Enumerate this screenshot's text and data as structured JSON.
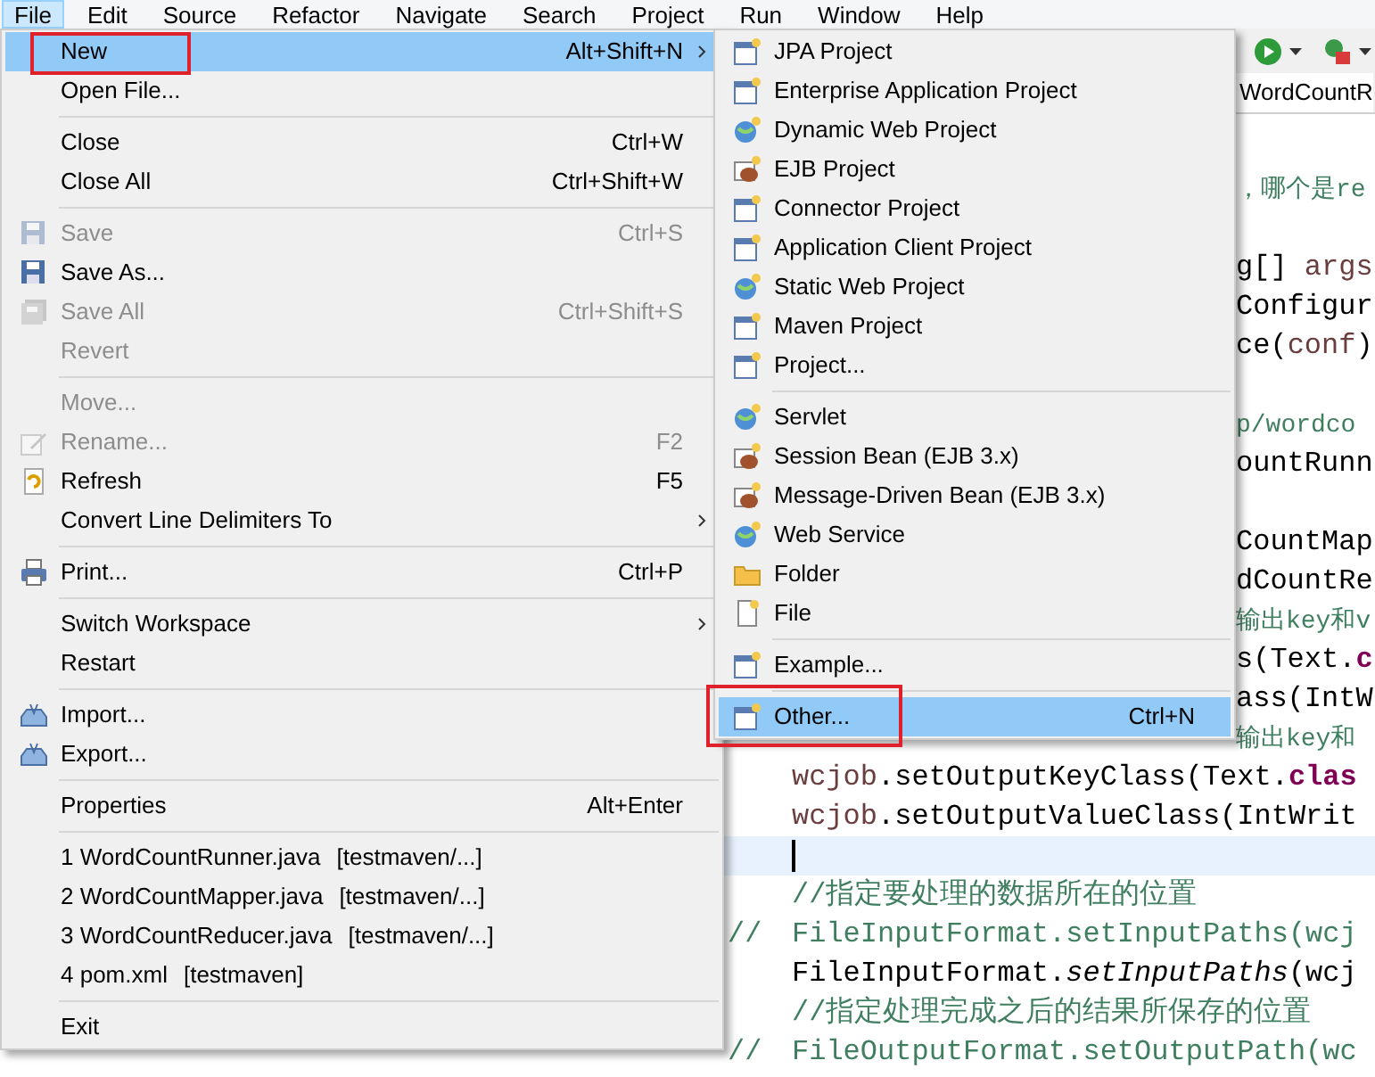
{
  "menu_bar": [
    {
      "label": "File",
      "selected": true
    },
    {
      "label": "Edit",
      "selected": false
    },
    {
      "label": "Source",
      "selected": false
    },
    {
      "label": "Refactor",
      "selected": false
    },
    {
      "label": "Navigate",
      "selected": false
    },
    {
      "label": "Search",
      "selected": false
    },
    {
      "label": "Project",
      "selected": false
    },
    {
      "label": "Run",
      "selected": false
    },
    {
      "label": "Window",
      "selected": false
    },
    {
      "label": "Help",
      "selected": false
    }
  ],
  "editor": {
    "tab": "WordCountR",
    "lines": [
      {
        "kind": "covered",
        "segments": [
          {
            "kind": "comment",
            "text": "，哪个是re"
          }
        ]
      },
      {
        "kind": "blank"
      },
      {
        "kind": "covered",
        "segments": [
          {
            "kind": "plain",
            "text": "g[] "
          },
          {
            "kind": "variable",
            "text": "args"
          }
        ]
      },
      {
        "kind": "covered",
        "segments": [
          {
            "kind": "plain",
            "text": "Configur"
          }
        ]
      },
      {
        "kind": "covered",
        "segments": [
          {
            "kind": "plain",
            "text": "ce("
          },
          {
            "kind": "variable",
            "text": "conf"
          },
          {
            "kind": "plain",
            "text": ")"
          }
        ]
      },
      {
        "kind": "blank"
      },
      {
        "kind": "covered",
        "segments": [
          {
            "kind": "comment",
            "text": "p/wordco"
          }
        ]
      },
      {
        "kind": "covered",
        "segments": [
          {
            "kind": "plain",
            "text": "ountRunn"
          }
        ]
      },
      {
        "kind": "blank"
      },
      {
        "kind": "covered",
        "segments": [
          {
            "kind": "plain",
            "text": "CountMap"
          }
        ]
      },
      {
        "kind": "covered",
        "segments": [
          {
            "kind": "plain",
            "text": "dCountRe"
          }
        ]
      },
      {
        "kind": "covered",
        "segments": [
          {
            "kind": "comment",
            "text": "输出key和v"
          }
        ]
      },
      {
        "kind": "covered",
        "segments": [
          {
            "kind": "plain",
            "text": "s(Text."
          },
          {
            "kind": "keyword",
            "text": "c"
          }
        ]
      },
      {
        "kind": "covered",
        "segments": [
          {
            "kind": "plain",
            "text": "ass(IntW"
          }
        ]
      },
      {
        "kind": "covered",
        "segments": [
          {
            "kind": "comment",
            "text": "输出key和"
          }
        ]
      },
      {
        "kind": "full",
        "segments": [
          {
            "kind": "variable",
            "text": "wcjob"
          },
          {
            "kind": "plain",
            "text": ".setOutputKeyClass(Text."
          },
          {
            "kind": "keyword",
            "text": "clas"
          }
        ]
      },
      {
        "kind": "full",
        "segments": [
          {
            "kind": "variable",
            "text": "wcjob"
          },
          {
            "kind": "plain",
            "text": ".setOutputValueClass(IntWrit"
          }
        ]
      },
      {
        "kind": "cursor"
      },
      {
        "kind": "full",
        "segments": [
          {
            "kind": "comment",
            "text": "//指定要处理的数据所在的位置"
          }
        ]
      },
      {
        "kind": "commented",
        "prefix": "//",
        "segments": [
          {
            "kind": "comment",
            "text": "FileInputFormat.setInputPaths(wcj"
          }
        ]
      },
      {
        "kind": "full",
        "segments": [
          {
            "kind": "plain",
            "text": "FileInputFormat."
          },
          {
            "kind": "italic",
            "text": "setInputPaths"
          },
          {
            "kind": "plain",
            "text": "(wcj"
          }
        ]
      },
      {
        "kind": "full",
        "segments": [
          {
            "kind": "comment",
            "text": "//指定处理完成之后的结果所保存的位置"
          }
        ]
      },
      {
        "kind": "commented",
        "prefix": "//",
        "segments": [
          {
            "kind": "comment",
            "text": "FileOutputFormat.setOutputPath(wc"
          }
        ]
      }
    ]
  },
  "file_menu": {
    "items": [
      {
        "kind": "item",
        "label": "New",
        "shortcut": "Alt+Shift+N",
        "selected": true,
        "disabled": false,
        "submenu": true,
        "annotated": true
      },
      {
        "kind": "item",
        "label": "Open File...",
        "selected": false,
        "disabled": false,
        "submenu": false,
        "annotated": false
      },
      {
        "kind": "separator"
      },
      {
        "kind": "item",
        "label": "Close",
        "shortcut": "Ctrl+W",
        "selected": false,
        "disabled": false,
        "submenu": false,
        "annotated": false
      },
      {
        "kind": "item",
        "label": "Close All",
        "shortcut": "Ctrl+Shift+W",
        "selected": false,
        "disabled": false,
        "submenu": false,
        "annotated": false
      },
      {
        "kind": "separator"
      },
      {
        "kind": "item",
        "label": "Save",
        "shortcut": "Ctrl+S",
        "selected": false,
        "disabled": true,
        "submenu": false,
        "annotated": false
      },
      {
        "kind": "item",
        "label": "Save As...",
        "selected": false,
        "disabled": false,
        "submenu": false,
        "annotated": false
      },
      {
        "kind": "item",
        "label": "Save All",
        "shortcut": "Ctrl+Shift+S",
        "selected": false,
        "disabled": true,
        "submenu": false,
        "annotated": false
      },
      {
        "kind": "item",
        "label": "Revert",
        "selected": false,
        "disabled": true,
        "submenu": false,
        "annotated": false
      },
      {
        "kind": "separator"
      },
      {
        "kind": "item",
        "label": "Move...",
        "selected": false,
        "disabled": true,
        "submenu": false,
        "annotated": false
      },
      {
        "kind": "item",
        "label": "Rename...",
        "shortcut": "F2",
        "selected": false,
        "disabled": true,
        "submenu": false,
        "annotated": false
      },
      {
        "kind": "item",
        "label": "Refresh",
        "shortcut": "F5",
        "selected": false,
        "disabled": false,
        "submenu": false,
        "annotated": false
      },
      {
        "kind": "item",
        "label": "Convert Line Delimiters To",
        "selected": false,
        "disabled": false,
        "submenu": true,
        "annotated": false
      },
      {
        "kind": "separator"
      },
      {
        "kind": "item",
        "label": "Print...",
        "shortcut": "Ctrl+P",
        "selected": false,
        "disabled": false,
        "submenu": false,
        "annotated": false
      },
      {
        "kind": "separator"
      },
      {
        "kind": "item",
        "label": "Switch Workspace",
        "selected": false,
        "disabled": false,
        "submenu": true,
        "annotated": false
      },
      {
        "kind": "item",
        "label": "Restart",
        "selected": false,
        "disabled": false,
        "submenu": false,
        "annotated": false
      },
      {
        "kind": "separator"
      },
      {
        "kind": "item",
        "label": "Import...",
        "selected": false,
        "disabled": false,
        "submenu": false,
        "annotated": false
      },
      {
        "kind": "item",
        "label": "Export...",
        "selected": false,
        "disabled": false,
        "submenu": false,
        "annotated": false
      },
      {
        "kind": "separator"
      },
      {
        "kind": "item",
        "label": "Properties",
        "shortcut": "Alt+Enter",
        "selected": false,
        "disabled": false,
        "submenu": false,
        "annotated": false
      },
      {
        "kind": "separator"
      },
      {
        "kind": "item",
        "label": "1 WordCountRunner.java",
        "detail": "[testmaven/...]",
        "selected": false,
        "disabled": false,
        "submenu": false,
        "annotated": false
      },
      {
        "kind": "item",
        "label": "2 WordCountMapper.java",
        "detail": "[testmaven/...]",
        "selected": false,
        "disabled": false,
        "submenu": false,
        "annotated": false
      },
      {
        "kind": "item",
        "label": "3 WordCountReducer.java",
        "detail": "[testmaven/...]",
        "selected": false,
        "disabled": false,
        "submenu": false,
        "annotated": false
      },
      {
        "kind": "item",
        "label": "4 pom.xml",
        "detail": "[testmaven]",
        "selected": false,
        "disabled": false,
        "submenu": false,
        "annotated": false
      },
      {
        "kind": "separator"
      },
      {
        "kind": "item",
        "label": "Exit",
        "selected": false,
        "disabled": false,
        "submenu": false,
        "annotated": false
      }
    ]
  },
  "new_submenu": {
    "items": [
      {
        "kind": "item",
        "label": "JPA Project",
        "selected": false,
        "annotated": false
      },
      {
        "kind": "item",
        "label": "Enterprise Application Project",
        "selected": false,
        "annotated": false
      },
      {
        "kind": "item",
        "label": "Dynamic Web Project",
        "selected": false,
        "annotated": false
      },
      {
        "kind": "item",
        "label": "EJB Project",
        "selected": false,
        "annotated": false
      },
      {
        "kind": "item",
        "label": "Connector Project",
        "selected": false,
        "annotated": false
      },
      {
        "kind": "item",
        "label": "Application Client Project",
        "selected": false,
        "annotated": false
      },
      {
        "kind": "item",
        "label": "Static Web Project",
        "selected": false,
        "annotated": false
      },
      {
        "kind": "item",
        "label": "Maven Project",
        "selected": false,
        "annotated": false
      },
      {
        "kind": "item",
        "label": "Project...",
        "selected": false,
        "annotated": false
      },
      {
        "kind": "separator"
      },
      {
        "kind": "item",
        "label": "Servlet",
        "selected": false,
        "annotated": false
      },
      {
        "kind": "item",
        "label": "Session Bean (EJB 3.x)",
        "selected": false,
        "annotated": false
      },
      {
        "kind": "item",
        "label": "Message-Driven Bean (EJB 3.x)",
        "selected": false,
        "annotated": false
      },
      {
        "kind": "item",
        "label": "Web Service",
        "selected": false,
        "annotated": false
      },
      {
        "kind": "item",
        "label": "Folder",
        "selected": false,
        "annotated": false
      },
      {
        "kind": "item",
        "label": "File",
        "selected": false,
        "annotated": false
      },
      {
        "kind": "separator"
      },
      {
        "kind": "item",
        "label": "Example...",
        "selected": false,
        "annotated": false
      },
      {
        "kind": "separator"
      },
      {
        "kind": "item",
        "label": "Other...",
        "shortcut": "Ctrl+N",
        "selected": true,
        "annotated": true
      }
    ]
  }
}
